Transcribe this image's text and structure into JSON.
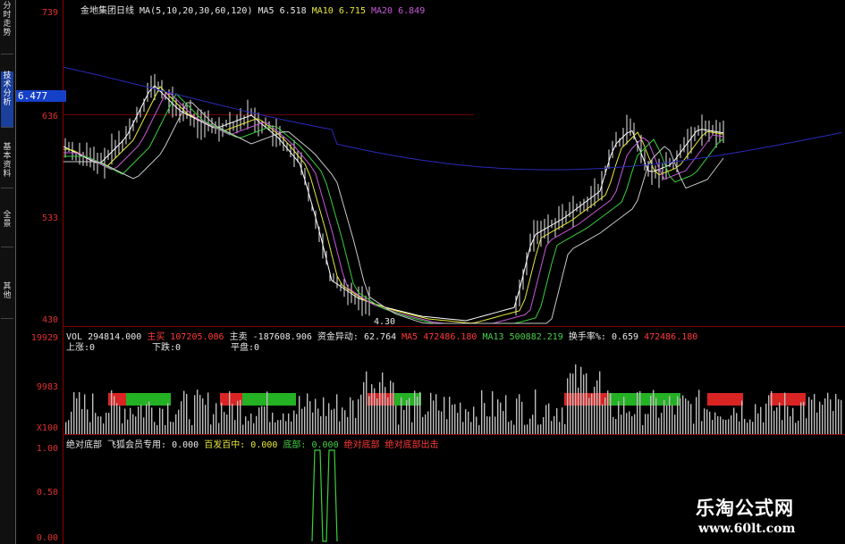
{
  "left_tabs": [
    {
      "label": "分时走势",
      "active": false
    },
    {
      "label": "技术分析",
      "active": true
    },
    {
      "label": "基本资料",
      "active": false
    },
    {
      "label": "全景",
      "active": false
    },
    {
      "label": "其他",
      "active": false
    }
  ],
  "price_panel": {
    "title": "金地集团日线",
    "ma_params": "MA(5,10,20,30,60,120)",
    "ma5_label": "MA5",
    "ma5_value": "6.518",
    "ma10_label": "MA10",
    "ma10_value": "6.715",
    "ma20_label": "MA20",
    "ma20_value": "6.849",
    "y_ticks": [
      "739",
      "636",
      "533",
      "430"
    ],
    "current_price": "6.477",
    "low_marker": "4.30"
  },
  "volume_panel": {
    "vol_label": "VOL",
    "vol_value": "294814.000",
    "main_buy_label": "主买",
    "main_buy_value": "107205.086",
    "main_sell_label": "主卖",
    "main_sell_value": "-187608.906",
    "fund_label": "资金异动:",
    "fund_value": "62.764",
    "ma5_label": "MA5",
    "ma5_value": "472486.180",
    "ma13_label": "MA13",
    "ma13_value": "500882.219",
    "turnover_label": "换手率%:",
    "turnover_value": "0.659",
    "extra_value": "472486.180",
    "rise_label": "上涨:0",
    "fall_label": "下跌:0",
    "flat_label": "平盘:0",
    "y_ticks": [
      "19929",
      "9983",
      "X100"
    ]
  },
  "indicator_panel": {
    "name": "绝对底部",
    "line1_label": "飞狐会员专用:",
    "line1_value": "0.000",
    "line2_label": "百发百中:",
    "line2_value": "0.000",
    "line3_label": "底部:",
    "line3_value": "0.000",
    "line4_label": "绝对底部",
    "line5_label": "绝对底部出击",
    "y_ticks": [
      "1.00",
      "0.50",
      "0.00"
    ]
  },
  "watermark": {
    "title": "乐淘公式网",
    "url": "www.60lt.com"
  },
  "colors": {
    "axis": "#8b0000",
    "ma5": "#ffffff",
    "ma10": "#e8e83a",
    "ma20": "#c85ad8",
    "ma30": "#3ad03a",
    "ma60": "#c8c8c8",
    "ma120": "#2a2ab8",
    "up_fill": "#ff2a2a",
    "down_fill": "#2ad02a"
  }
}
